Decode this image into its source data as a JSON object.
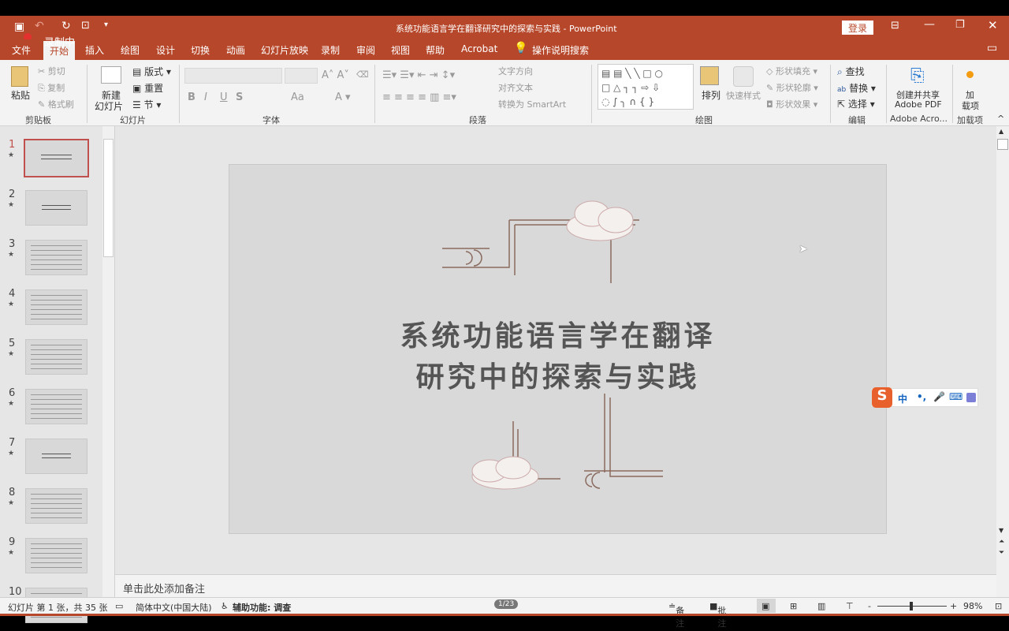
{
  "titlebar": {
    "title": "系统功能语言学在翻译研究中的探索与实践 - PowerPoint",
    "login": "登录",
    "recording": "录制中",
    "qat_more": "▾"
  },
  "tabs": [
    "文件",
    "开始",
    "插入",
    "绘图",
    "设计",
    "切换",
    "动画",
    "幻灯片放映",
    "录制",
    "审阅",
    "视图",
    "帮助",
    "Acrobat"
  ],
  "search": "操作说明搜索",
  "ribbon": {
    "clipboard": {
      "label": "剪贴板",
      "paste": "粘贴",
      "cut": "剪切",
      "copy": "复制",
      "format_painter": "格式刷"
    },
    "slides": {
      "label": "幻灯片",
      "new_slide_1": "新建",
      "new_slide_2": "幻灯片",
      "layout": "版式",
      "reset": "重置",
      "section": "节"
    },
    "font": {
      "label": "字体",
      "bold": "B",
      "italic": "I",
      "underline": "U",
      "strike": "S",
      "case": "Aa"
    },
    "paragraph": {
      "label": "段落",
      "text_direction": "文字方向",
      "align_text": "对齐文本",
      "smartart": "转换为 SmartArt"
    },
    "drawing": {
      "label": "绘图",
      "arrange": "排列",
      "quick_styles": "快速样式",
      "fill": "形状填充",
      "outline": "形状轮廓",
      "effects": "形状效果"
    },
    "editing": {
      "label": "编辑",
      "find": "查找",
      "replace": "替换",
      "select": "选择"
    },
    "adobe": {
      "label": "Adobe Acro...",
      "create_1": "创建并共享",
      "create_2": "Adobe PDF"
    },
    "addins": {
      "label": "加载项",
      "btn_1": "加",
      "btn_2": "载项"
    }
  },
  "thumbnails": [
    "1",
    "2",
    "3",
    "4",
    "5",
    "6",
    "7",
    "8",
    "9",
    "10"
  ],
  "slide": {
    "title_line1": "系统功能语言学在翻译",
    "title_line2": "研究中的探索与实践"
  },
  "notes_placeholder": "单击此处添加备注",
  "ime": {
    "lang": "中",
    "punct": "•,",
    "mic": "🎤",
    "kbd": "⌨"
  },
  "status": {
    "slide_info": "幻灯片 第 1 张，共 35 张",
    "language": "简体中文(中国大陆)",
    "accessibility": "辅助功能: 调查",
    "badge": "1/23",
    "notes": "备注",
    "comments": "批注",
    "zoom": "98%"
  },
  "colors": {
    "accent": "#b7472a",
    "selection": "#c0504d"
  }
}
